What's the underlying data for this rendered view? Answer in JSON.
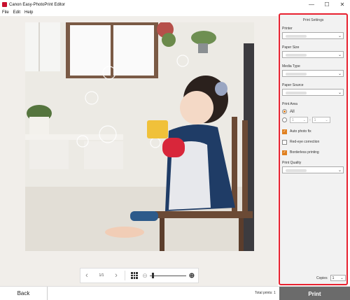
{
  "window": {
    "title": "Canon Easy-PhotoPrint Editor",
    "minimize": "—",
    "maximize": "☐",
    "close": "✕"
  },
  "menu": [
    "File",
    "Edit",
    "Help"
  ],
  "preview": {
    "page_counter": "1/1",
    "prev_icon": "chevron-left-icon",
    "next_icon": "chevron-right-icon",
    "grid_icon": "grid-icon",
    "zoom_out_icon": "zoom-out-icon",
    "zoom_in_icon": "zoom-in-icon",
    "zoom_level_fraction": 0.05
  },
  "settings": {
    "title": "Print Settings",
    "printer_label": "Printer",
    "paper_size_label": "Paper Size",
    "media_type_label": "Media Type",
    "paper_source_label": "Paper Source",
    "print_area_label": "Print Area",
    "print_area_all": "All",
    "print_area_from": "1",
    "print_area_to": "1",
    "print_area_selected": "All",
    "auto_photo_fix": {
      "label": "Auto photo fix",
      "checked": true
    },
    "red_eye": {
      "label": "Red-eye correction",
      "checked": false
    },
    "borderless": {
      "label": "Borderless printing",
      "checked": true
    },
    "print_quality_label": "Print Quality",
    "copies_label": "Copies",
    "copies_value": "1"
  },
  "footer": {
    "back_label": "Back",
    "total_prints": "Total prints: 1",
    "print_label": "Print"
  },
  "colors": {
    "accent_orange": "#e08020",
    "highlight_red": "#e8212f",
    "print_button": "#6b6b6b"
  }
}
